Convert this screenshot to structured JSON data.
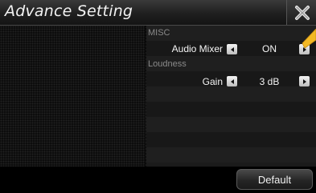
{
  "window": {
    "title": "Advance Setting",
    "close_icon": "close-icon"
  },
  "misc": {
    "header": "MISC",
    "audio_mixer": {
      "label": "Audio Mixer",
      "value": "ON"
    }
  },
  "loudness": {
    "header": "Loudness",
    "gain": {
      "label": "Gain",
      "value": "3 dB"
    }
  },
  "footer": {
    "default_label": "Default"
  },
  "colors": {
    "accent_pointer": "#f2b824"
  },
  "icons": {
    "decrease": "arrow-left-icon",
    "increase": "arrow-right-icon"
  }
}
